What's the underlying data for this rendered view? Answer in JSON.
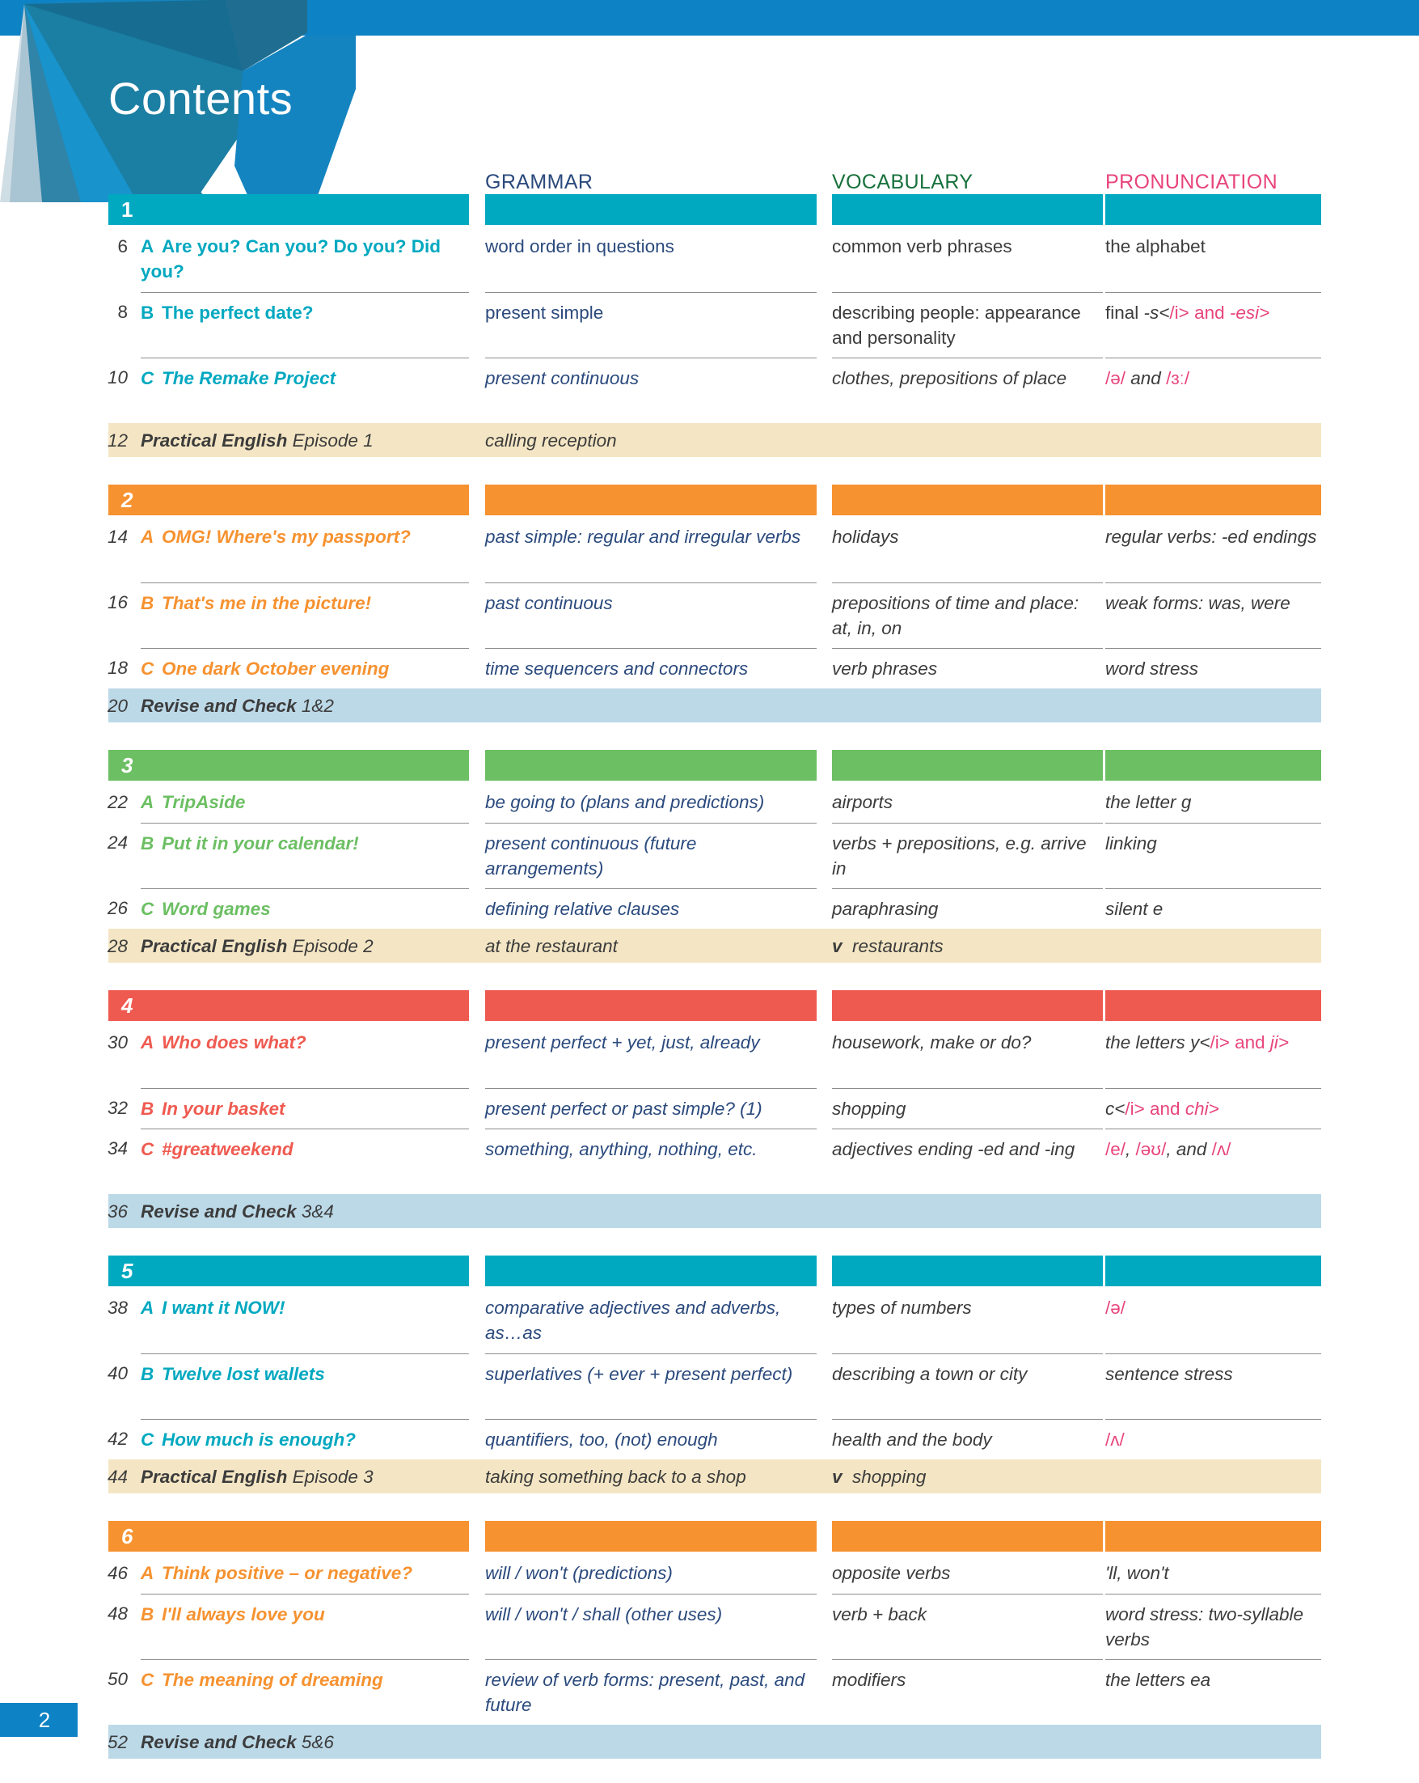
{
  "page": {
    "heading": "Contents",
    "page_number": "2"
  },
  "column_headers": {
    "grammar": "GRAMMAR",
    "vocabulary": "VOCABULARY",
    "pronunciation": "PRONUNCIATION"
  },
  "colors": {
    "banner_blue": "#0d82c4",
    "unit1_teal": "#00a8c0",
    "unit2_orange": "#f69230",
    "unit3_green": "#6cbf63",
    "unit4_red": "#ef5a50",
    "unit5_teal": "#00a8c0",
    "unit6_orange": "#f69230",
    "practical_cream": "#f4e6c4",
    "revise_blue": "#bcd9e8",
    "grammar_header": "#2b4a7d",
    "vocabulary_header": "#17713c",
    "pronunciation_header": "#e8457c",
    "grammar_text": "#2b4a7d",
    "phonetic_pink": "#e8457c"
  },
  "units": [
    {
      "number": "1",
      "color": "#00a8c0",
      "lessons": [
        {
          "page": "6",
          "letter": "A",
          "title": "Are you? Can you? Do you? Did you?",
          "grammar": "word order in questions",
          "vocabulary": "common verb phrases",
          "pronunciation": "the alphabet"
        },
        {
          "page": "8",
          "letter": "B",
          "title": "The perfect date?",
          "grammar": "present simple",
          "vocabulary": "describing people: appearance and personality",
          "pronunciation": "final -s and -es"
        },
        {
          "page": "10",
          "letter": "C",
          "title": "The Remake Project",
          "grammar": "present continuous",
          "vocabulary": "clothes, prepositions of place",
          "pronunciation": "/ə/ and /ɜː/"
        }
      ],
      "strip": {
        "type": "practical",
        "page": "12",
        "bold_label": "Practical English",
        "rest_label": " Episode 1",
        "grammar": "calling reception",
        "vocabulary": ""
      }
    },
    {
      "number": "2",
      "color": "#f69230",
      "lessons": [
        {
          "page": "14",
          "letter": "A",
          "title": "OMG! Where's my passport?",
          "grammar": "past simple: regular and irregular verbs",
          "vocabulary": "holidays",
          "pronunciation": "regular verbs: -ed endings"
        },
        {
          "page": "16",
          "letter": "B",
          "title": "That's me in the picture!",
          "grammar": "past continuous",
          "vocabulary": "prepositions of time and place: at, in, on",
          "pronunciation": "weak forms: was, were"
        },
        {
          "page": "18",
          "letter": "C",
          "title": "One dark October evening",
          "grammar": "time sequencers and connectors",
          "vocabulary": "verb phrases",
          "pronunciation": "word stress"
        }
      ],
      "strip": {
        "type": "revise",
        "page": "20",
        "bold_label": "Revise and Check",
        "rest_label": " 1&2",
        "grammar": "",
        "vocabulary": ""
      }
    },
    {
      "number": "3",
      "color": "#6cbf63",
      "lessons": [
        {
          "page": "22",
          "letter": "A",
          "title": "TripAside",
          "grammar": "be going to (plans and predictions)",
          "vocabulary": "airports",
          "pronunciation": "the letter g"
        },
        {
          "page": "24",
          "letter": "B",
          "title": "Put it in your calendar!",
          "grammar": "present continuous (future arrangements)",
          "vocabulary": "verbs + prepositions, e.g. arrive in",
          "pronunciation": "linking"
        },
        {
          "page": "26",
          "letter": "C",
          "title": "Word games",
          "grammar": "defining relative clauses",
          "vocabulary": "paraphrasing",
          "pronunciation": "silent e"
        }
      ],
      "strip": {
        "type": "practical",
        "page": "28",
        "bold_label": "Practical English",
        "rest_label": " Episode 2",
        "grammar": "at the restaurant",
        "vocabulary": "restaurants",
        "voc_marker": "v"
      }
    },
    {
      "number": "4",
      "color": "#ef5a50",
      "lessons": [
        {
          "page": "30",
          "letter": "A",
          "title": "Who does what?",
          "grammar": "present perfect + yet, just, already",
          "vocabulary": "housework, make or do?",
          "pronunciation": "the letters y and j"
        },
        {
          "page": "32",
          "letter": "B",
          "title": "In your basket",
          "grammar": "present perfect or past simple? (1)",
          "vocabulary": "shopping",
          "pronunciation": "c and ch"
        },
        {
          "page": "34",
          "letter": "C",
          "title": "#greatweekend",
          "grammar": "something, anything, nothing, etc.",
          "vocabulary": "adjectives ending -ed and -ing",
          "pronunciation": "/e/, /əʊ/, and /ʌ/"
        }
      ],
      "strip": {
        "type": "revise",
        "page": "36",
        "bold_label": "Revise and Check",
        "rest_label": " 3&4",
        "grammar": "",
        "vocabulary": ""
      }
    },
    {
      "number": "5",
      "color": "#00a8c0",
      "lessons": [
        {
          "page": "38",
          "letter": "A",
          "title": "I want it NOW!",
          "grammar": "comparative adjectives and adverbs, as…as",
          "vocabulary": "types of numbers",
          "pronunciation": "/ə/"
        },
        {
          "page": "40",
          "letter": "B",
          "title": "Twelve lost wallets",
          "grammar": "superlatives (+ ever + present perfect)",
          "vocabulary": "describing a town or city",
          "pronunciation": "sentence stress"
        },
        {
          "page": "42",
          "letter": "C",
          "title": "How much is enough?",
          "grammar": "quantifiers, too, (not) enough",
          "vocabulary": "health and the body",
          "pronunciation": "/ʌ/"
        }
      ],
      "strip": {
        "type": "practical",
        "page": "44",
        "bold_label": "Practical English",
        "rest_label": " Episode 3",
        "grammar": "taking something back to a shop",
        "vocabulary": "shopping",
        "voc_marker": "v"
      }
    },
    {
      "number": "6",
      "color": "#f69230",
      "lessons": [
        {
          "page": "46",
          "letter": "A",
          "title": "Think positive – or negative?",
          "grammar": "will / won't (predictions)",
          "vocabulary": "opposite verbs",
          "pronunciation": "'ll, won't"
        },
        {
          "page": "48",
          "letter": "B",
          "title": "I'll always love you",
          "grammar": "will / won't / shall (other uses)",
          "vocabulary": "verb + back",
          "pronunciation": "word stress: two-syllable verbs"
        },
        {
          "page": "50",
          "letter": "C",
          "title": "The meaning of dreaming",
          "grammar": "review of verb forms: present, past, and future",
          "vocabulary": "modifiers",
          "pronunciation": "the letters ea"
        }
      ],
      "strip": {
        "type": "revise",
        "page": "52",
        "bold_label": "Revise and Check",
        "rest_label": " 5&6",
        "grammar": "",
        "vocabulary": ""
      }
    }
  ]
}
